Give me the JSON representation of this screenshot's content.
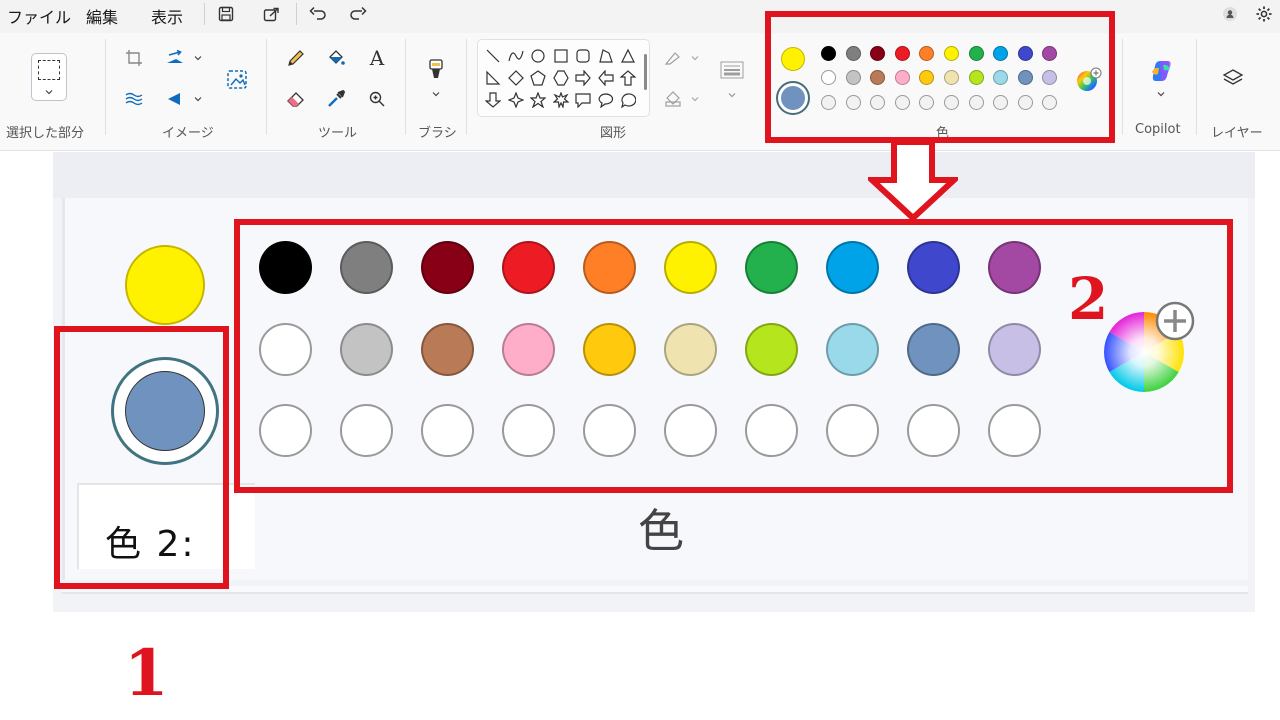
{
  "menu": {
    "file": "ファイル",
    "edit": "編集",
    "view": "表示"
  },
  "groups": {
    "selection": "選択した部分",
    "image": "イメージ",
    "tools": "ツール",
    "brush": "ブラシ",
    "shapes": "図形",
    "colors": "色",
    "copilot": "Copilot",
    "layers": "レイヤー"
  },
  "colors": {
    "color1": "#fef200",
    "color2": "#7092be",
    "palette_row1": [
      "#000000",
      "#7f7f7f",
      "#880015",
      "#ed1c24",
      "#ff7f27",
      "#fff200",
      "#22b14c",
      "#00a2e8",
      "#3f48cc",
      "#a349a4"
    ],
    "palette_row2": [
      "#ffffff",
      "#c3c3c3",
      "#b97a57",
      "#ffaec9",
      "#ffc90e",
      "#efe4b0",
      "#b5e61d",
      "#99d9ea",
      "#7092be",
      "#c8bfe7"
    ],
    "custom_slots": 10,
    "annotation_red": "#e0141e"
  },
  "zoom": {
    "color2_label": "色 2:",
    "colors_label": "色"
  },
  "annotations": {
    "label_1": "1",
    "label_2": "2"
  }
}
